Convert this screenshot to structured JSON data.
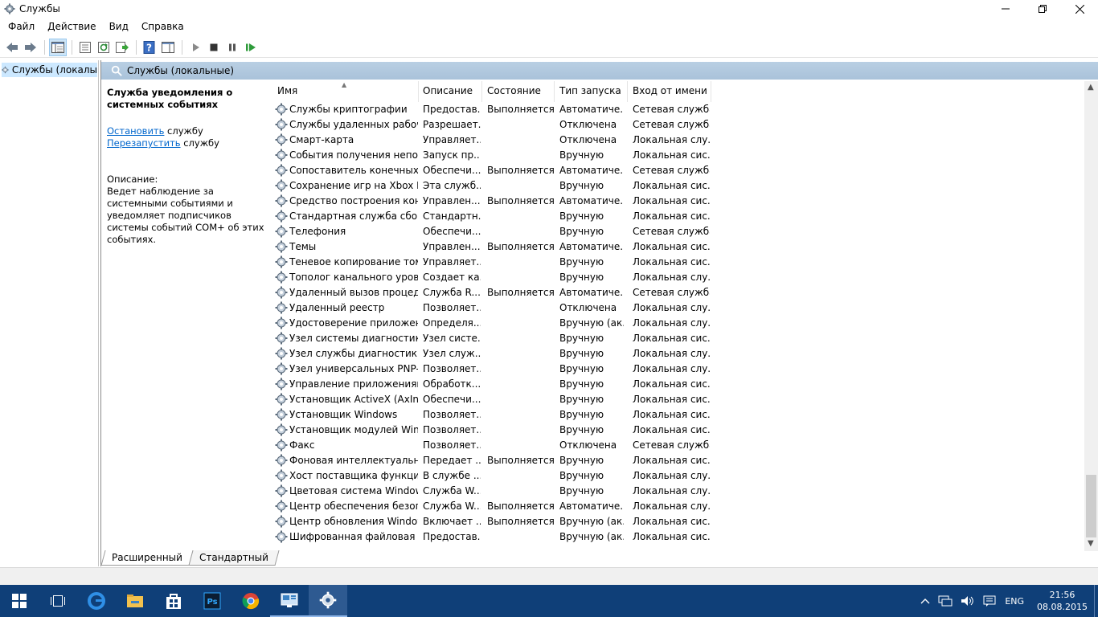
{
  "window": {
    "title": "Службы"
  },
  "menu": [
    "Файл",
    "Действие",
    "Вид",
    "Справка"
  ],
  "tree": {
    "item": "Службы (локалы"
  },
  "pane": {
    "header": "Службы (локальные)"
  },
  "description": {
    "service_title": "Служба уведомления о системных событиях",
    "stop_link": "Остановить",
    "stop_suffix": " службу",
    "restart_link": "Перезапустить",
    "restart_suffix": " службу",
    "desc_label": "Описание:",
    "desc_text": "Ведет наблюдение за системными событиями и уведомляет подписчиков системы событий COM+ об этих событиях."
  },
  "table": {
    "headers": [
      "Имя",
      "Описание",
      "Состояние",
      "Тип запуска",
      "Вход от имени"
    ],
    "rows": [
      [
        "Службы криптографии",
        "Предостав...",
        "Выполняется",
        "Автоматиче...",
        "Сетевая служба"
      ],
      [
        "Службы удаленных рабоч...",
        "Разрешает...",
        "",
        "Отключена",
        "Сетевая служба"
      ],
      [
        "Смарт-карта",
        "Управляет...",
        "",
        "Отключена",
        "Локальная слу..."
      ],
      [
        "События получения непо...",
        "Запуск пр...",
        "",
        "Вручную",
        "Локальная сис..."
      ],
      [
        "Сопоставитель конечных ...",
        "Обеспечи...",
        "Выполняется",
        "Автоматиче...",
        "Сетевая служба"
      ],
      [
        "Сохранение игр на Xbox Li...",
        "Эта служб...",
        "",
        "Вручную",
        "Локальная сис..."
      ],
      [
        "Средство построения кон...",
        "Управлен...",
        "Выполняется",
        "Автоматиче...",
        "Локальная сис..."
      ],
      [
        "Стандартная служба сбор...",
        "Стандартн...",
        "",
        "Вручную",
        "Локальная сис..."
      ],
      [
        "Телефония",
        "Обеспечи...",
        "",
        "Вручную",
        "Сетевая служба"
      ],
      [
        "Темы",
        "Управлен...",
        "Выполняется",
        "Автоматиче...",
        "Локальная сис..."
      ],
      [
        "Теневое копирование тома",
        "Управляет...",
        "",
        "Вручную",
        "Локальная сис..."
      ],
      [
        "Тополог канального уровня",
        "Создает ка...",
        "",
        "Вручную",
        "Локальная слу..."
      ],
      [
        "Удаленный вызов процеду...",
        "Служба R...",
        "Выполняется",
        "Автоматиче...",
        "Сетевая служба"
      ],
      [
        "Удаленный реестр",
        "Позволяет...",
        "",
        "Отключена",
        "Локальная слу..."
      ],
      [
        "Удостоверение приложения",
        "Определя...",
        "",
        "Вручную (ак...",
        "Локальная слу..."
      ],
      [
        "Узел системы диагностики",
        "Узел систе...",
        "",
        "Вручную",
        "Локальная сис..."
      ],
      [
        "Узел службы диагностики",
        "Узел служ...",
        "",
        "Вручную",
        "Локальная слу..."
      ],
      [
        "Узел универсальных PNP-...",
        "Позволяет...",
        "",
        "Вручную",
        "Локальная слу..."
      ],
      [
        "Управление приложениями",
        "Обработк...",
        "",
        "Вручную",
        "Локальная сис..."
      ],
      [
        "Установщик ActiveX (AxIns...",
        "Обеспечи...",
        "",
        "Вручную",
        "Локальная сис..."
      ],
      [
        "Установщик Windows",
        "Позволяет...",
        "",
        "Вручную",
        "Локальная сис..."
      ],
      [
        "Установщик модулей Win...",
        "Позволяет...",
        "",
        "Вручную",
        "Локальная сис..."
      ],
      [
        "Факс",
        "Позволяет...",
        "",
        "Отключена",
        "Сетевая служба"
      ],
      [
        "Фоновая интеллектуальна...",
        "Передает ...",
        "Выполняется",
        "Вручную",
        "Локальная сис..."
      ],
      [
        "Хост поставщика функци...",
        "В службе ...",
        "",
        "Вручную",
        "Локальная слу..."
      ],
      [
        "Цветовая система Window...",
        "Служба W...",
        "",
        "Вручную",
        "Локальная слу..."
      ],
      [
        "Центр обеспечения безоп...",
        "Служба W...",
        "Выполняется",
        "Автоматиче...",
        "Локальная слу..."
      ],
      [
        "Центр обновления Windows",
        "Включает ...",
        "Выполняется",
        "Вручную (ак...",
        "Локальная сис..."
      ],
      [
        "Шифрованная файловая с...",
        "Предостав...",
        "",
        "Вручную (ак...",
        "Локальная сис..."
      ]
    ]
  },
  "tabs": [
    "Расширенный",
    "Стандартный"
  ],
  "taskbar": {
    "lang": "ENG",
    "time": "21:56",
    "date": "08.08.2015",
    "apps": [
      "windows-start-icon",
      "task-view-icon",
      "edge-icon",
      "file-explorer-icon",
      "store-icon",
      "photoshop-icon",
      "chrome-icon",
      "control-panel-icon",
      "services-icon"
    ]
  },
  "colors": {
    "taskbar": "#0f3f78",
    "pane_header": "#b9cfe3",
    "link": "#0066cc",
    "selection": "#cce8ff"
  }
}
